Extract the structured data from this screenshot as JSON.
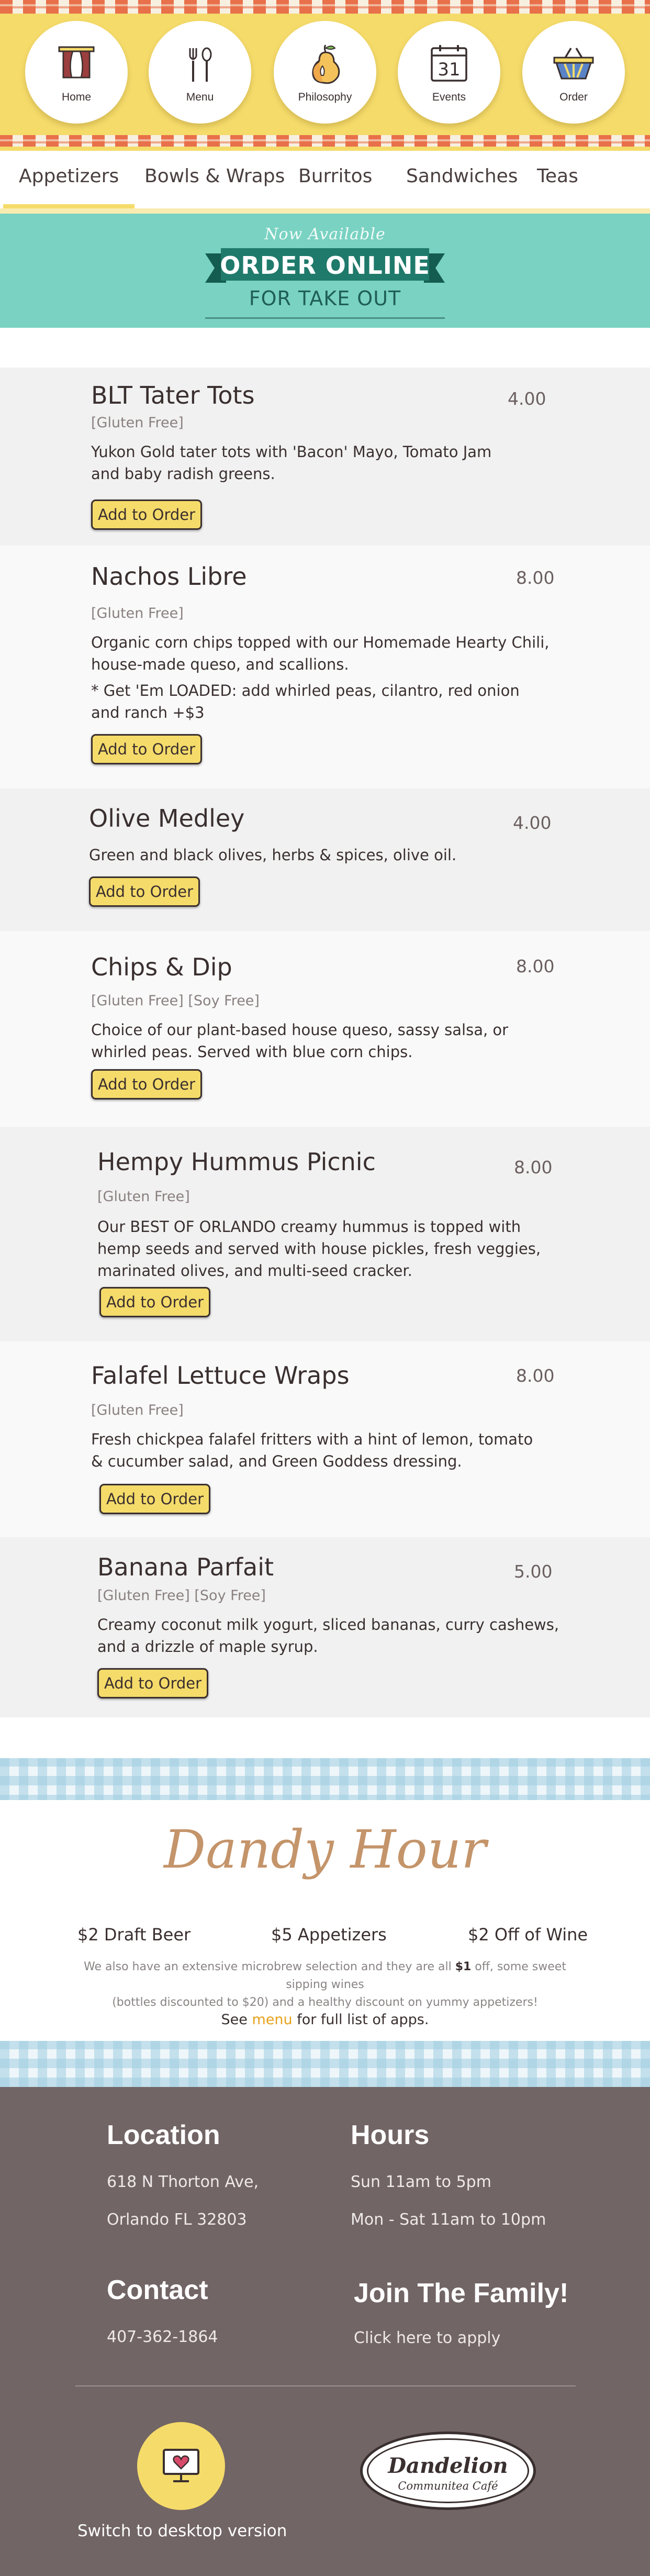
{
  "nav": {
    "items": [
      {
        "label": "Home",
        "icon": "window-curtains-icon"
      },
      {
        "label": "Menu",
        "icon": "fork-spoon-icon"
      },
      {
        "label": "Philosophy",
        "icon": "pear-icon"
      },
      {
        "label": "Events",
        "icon": "calendar-icon",
        "day": "31"
      },
      {
        "label": "Order",
        "icon": "basket-icon"
      }
    ]
  },
  "tabs": [
    "Appetizers",
    "Bowls & Wraps",
    "Burritos",
    "Sandwiches",
    "Teas"
  ],
  "active_tab": "Appetizers",
  "order_banner": {
    "kicker": "Now Available",
    "title": "ORDER ONLINE",
    "subtitle": "FOR TAKE OUT"
  },
  "menu_items": [
    {
      "name": "BLT Tater Tots",
      "price": "4.00",
      "tags": "[Gluten Free]",
      "desc": [
        "Yukon Gold tater tots with 'Bacon' Mayo, Tomato Jam",
        "and baby radish greens."
      ],
      "button": "Add to Order"
    },
    {
      "name": "Nachos Libre",
      "price": "8.00",
      "tags": "[Gluten Free]",
      "desc": [
        "Organic corn chips topped with our Homemade Hearty Chili,",
        "house-made queso, and scallions."
      ],
      "extra": [
        "* Get 'Em LOADED: add whirled peas, cilantro, red onion",
        "and ranch +$3"
      ],
      "button": "Add to Order"
    },
    {
      "name": "Olive Medley",
      "price": "4.00",
      "desc": [
        "Green and black olives, herbs & spices, olive oil."
      ],
      "button": "Add to Order"
    },
    {
      "name": "Chips & Dip",
      "price": "8.00",
      "tags": "[Gluten Free]    [Soy Free]",
      "desc": [
        "Choice of our plant-based house queso, sassy salsa, or",
        "whirled peas. Served with blue corn chips."
      ],
      "button": "Add to Order"
    },
    {
      "name": "Hempy Hummus Picnic",
      "price": "8.00",
      "tags": "[Gluten Free]",
      "desc": [
        "Our BEST OF ORLANDO creamy hummus is topped with",
        "hemp seeds and served with house pickles, fresh veggies,",
        "marinated olives, and multi-seed cracker."
      ],
      "button": "Add to Order"
    },
    {
      "name": "Falafel Lettuce Wraps",
      "price": "8.00",
      "tags": "[Gluten Free]",
      "desc": [
        "Fresh chickpea falafel fritters with a hint of lemon, tomato",
        "& cucumber salad, and Green Goddess dressing."
      ],
      "button": "Add to Order"
    },
    {
      "name": "Banana Parfait",
      "price": "5.00",
      "tags": "[Gluten Free]    [Soy Free]",
      "desc": [
        "Creamy coconut milk yogurt, sliced bananas, curry cashews,",
        "and a drizzle of maple syrup."
      ],
      "button": "Add to Order"
    }
  ],
  "dandy_hour": {
    "title": "Dandy Hour",
    "deals": [
      "$2 Draft Beer",
      "$5 Appetizers",
      "$2 Off of Wine"
    ],
    "note_before": "We also have an extensive microbrew selection and they are all ",
    "note_bold": "$1",
    "note_after": " off, some sweet sipping wines",
    "note_line2": "(bottles discounted to $20) and a healthy discount on yummy appetizers!",
    "see_before": "See ",
    "see_link": "menu",
    "see_after": " for full list of apps."
  },
  "footer": {
    "location_heading": "Location",
    "address1": "618 N Thorton Ave,",
    "address2": "Orlando FL 32803",
    "hours_heading": "Hours",
    "hours1": "Sun 11am to 5pm",
    "hours2": "Mon - Sat 11am to 10pm",
    "contact_heading": "Contact",
    "phone": "407-362-1864",
    "join_heading": "Join The Family!",
    "apply": "Click here to apply",
    "logo_main": "Dandelion",
    "logo_sub": "Communitea Café",
    "switch": "Switch to desktop version"
  },
  "colors": {
    "header_yellow": "#f5db6a",
    "stripe_orange": "#e8704a",
    "banner_teal": "#79d2c2",
    "ribbon_green": "#1f7a6b",
    "footer_brown": "#726565",
    "link_gold": "#e6a21b"
  }
}
